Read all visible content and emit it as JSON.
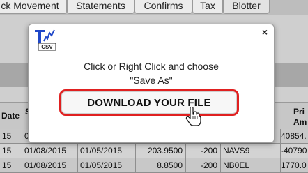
{
  "tabs": [
    {
      "label": "ck Movement"
    },
    {
      "label": "Statements"
    },
    {
      "label": "Confirms"
    },
    {
      "label": "Tax"
    },
    {
      "label": "Blotter"
    }
  ],
  "table": {
    "headers": {
      "col0": "Date",
      "col1": "S",
      "col6a": "Pri",
      "col6b": "Am"
    },
    "rows": [
      [
        "15",
        "01",
        "",
        "",
        "",
        "",
        "40854."
      ],
      [
        "15",
        "01/08/2015",
        "01/05/2015",
        "203.9500",
        "-200",
        "NAVS9",
        "-40790"
      ],
      [
        "15",
        "01/08/2015",
        "01/05/2015",
        "8.8500",
        "-200",
        "NB0EL",
        "1770.0"
      ]
    ]
  },
  "modal": {
    "logo": {
      "top": "T",
      "bottom": "CSV"
    },
    "close_glyph": "×",
    "instruction_line1": "Click or Right Click and choose",
    "instruction_line2": "\"Save As\"",
    "download_label": "DOWNLOAD YOUR FILE",
    "cursor_icon": "hand-pointer-icon"
  },
  "colors": {
    "download_border": "#e02020",
    "logo_blue": "#1f47c8",
    "logo_dark": "#2a2a2a"
  }
}
